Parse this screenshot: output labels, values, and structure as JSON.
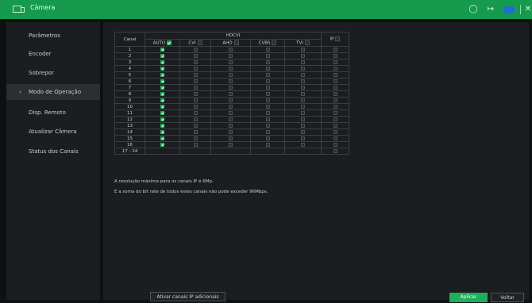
{
  "window": {
    "title": "Câmera"
  },
  "sidebar": {
    "items": [
      {
        "label": "Parâmetros",
        "active": false
      },
      {
        "label": "Encoder",
        "active": false
      },
      {
        "label": "Sobrepor",
        "active": false
      },
      {
        "label": "Modo de Operação",
        "active": true
      },
      {
        "label": "Disp. Remoto",
        "active": false
      },
      {
        "label": "Atualizar Câmera",
        "active": false
      },
      {
        "label": "Status dos Canais",
        "active": false
      }
    ]
  },
  "table": {
    "canal_header": "Canal",
    "group_header": "HDCVI",
    "columns": [
      "AUTO",
      "CVI",
      "AHD",
      "CVBS",
      "TVI"
    ],
    "ip_header": "IP",
    "rows": [
      "1",
      "2",
      "3",
      "4",
      "5",
      "6",
      "7",
      "8",
      "9",
      "10",
      "11",
      "12",
      "13",
      "14",
      "15",
      "16",
      "17 - 24"
    ]
  },
  "notes": {
    "line1": "A resolução máxima para os canais IP é 6Mp.",
    "line2": "E a soma do bit rate de todos estes canais não pode exceder 96Mbps."
  },
  "buttons": {
    "extra_ip": "Ativar canais IP adicionais",
    "apply": "Aplicar",
    "back": "Voltar"
  },
  "colors": {
    "titlebar": "#169a4e",
    "accent": "#1fae5a",
    "background": "#0f1012",
    "panel": "#1b1d20"
  }
}
